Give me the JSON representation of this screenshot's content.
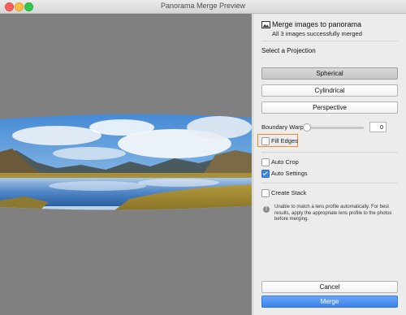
{
  "window": {
    "title": "Panorama Merge Preview"
  },
  "header": {
    "title": "Merge images to panorama",
    "subtitle": "All 3 images successfully merged"
  },
  "projection": {
    "label": "Select a Projection",
    "options": [
      "Spherical",
      "Cylindrical",
      "Perspective"
    ],
    "selected": "Spherical"
  },
  "boundary_warp": {
    "label": "Boundary Warp:",
    "value": "0",
    "level": 0
  },
  "options": {
    "fill_edges": {
      "label": "Fill Edges",
      "checked": false
    },
    "auto_crop": {
      "label": "Auto Crop",
      "checked": false
    },
    "auto_settings": {
      "label": "Auto Settings",
      "checked": true
    },
    "create_stack": {
      "label": "Create Stack",
      "checked": false
    }
  },
  "warning": {
    "icon": "info-icon",
    "text": "Unable to match a lens profile automatically. For best results, apply the appropriate lens profile to the photos before merging."
  },
  "buttons": {
    "cancel": "Cancel",
    "merge": "Merge"
  },
  "colors": {
    "accent": "#3b82ea",
    "highlight": "#ee8a2b",
    "preview_bg": "#808080"
  }
}
